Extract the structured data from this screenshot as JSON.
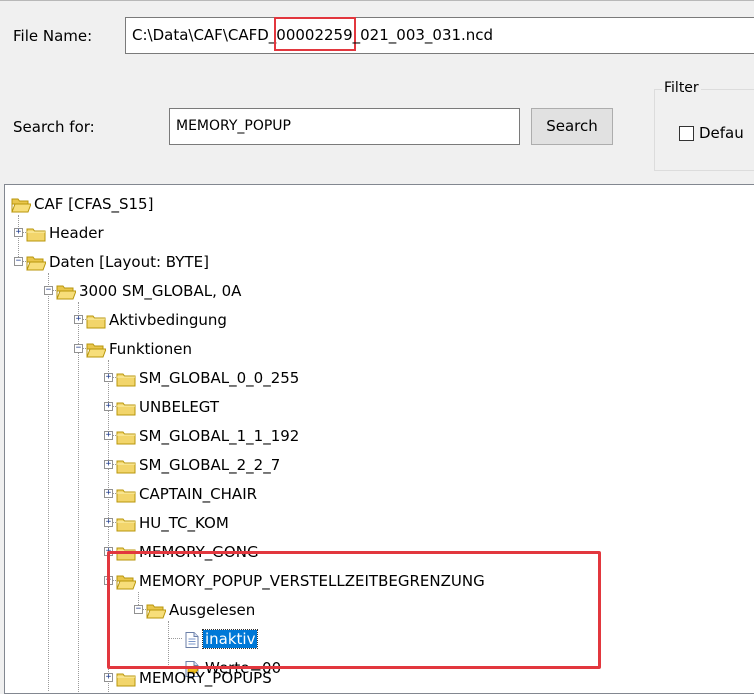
{
  "file": {
    "label": "File Name:",
    "path_pre": "C:\\Data\\CAF\\CAFD_",
    "path_highlight": "00002259",
    "path_post": "_021_003_031.ncd"
  },
  "search": {
    "label": "Search for:",
    "value": "MEMORY_POPUP",
    "button": "Search"
  },
  "filter": {
    "legend": "Filter",
    "checkbox_label": "Defau"
  },
  "tree": {
    "root": "CAF [CFAS_S15]",
    "header": "Header",
    "daten": "Daten [Layout: BYTE]",
    "sm_global": "3000 SM_GLOBAL, 0A",
    "aktivbedingung": "Aktivbedingung",
    "funktionen": "Funktionen",
    "functions": [
      "SM_GLOBAL_0_0_255",
      "UNBELEGT",
      "SM_GLOBAL_1_1_192",
      "SM_GLOBAL_2_2_7",
      "CAPTAIN_CHAIR",
      "HU_TC_KOM",
      "MEMORY_GONG"
    ],
    "verstell": "MEMORY_POPUP_VERSTELLZEITBEGRENZUNG",
    "ausgelesen": "Ausgelesen",
    "inaktiv": "inaktiv",
    "werte": "Werte=00",
    "popups": "MEMORY_POPUPS"
  },
  "colors": {
    "highlight_border": "#e2373e",
    "selection": "#0078d7",
    "folder": "#f2d56b"
  }
}
